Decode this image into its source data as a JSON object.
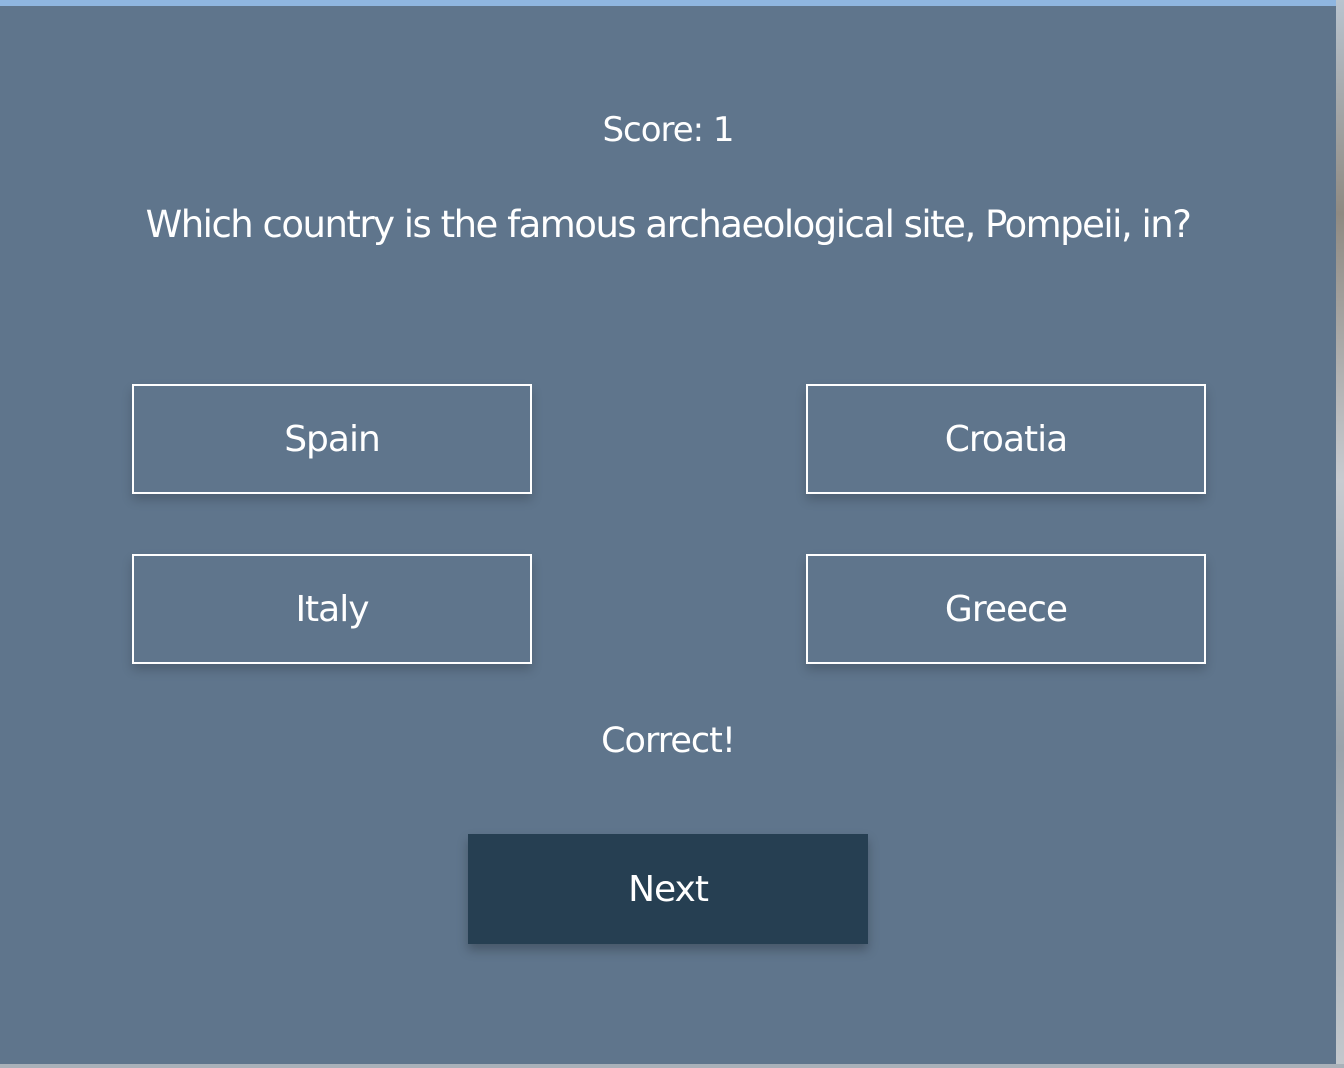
{
  "quiz": {
    "score_text": "Score: 1",
    "question": "Which country is the famous archaeological site, Pompeii, in?",
    "answers": [
      {
        "label": "Spain"
      },
      {
        "label": "Croatia"
      },
      {
        "label": "Italy"
      },
      {
        "label": "Greece"
      }
    ],
    "feedback": "Correct!",
    "next_label": "Next"
  },
  "colors": {
    "panel": "#5f758c",
    "next_button": "#263f52",
    "text": "#ffffff"
  }
}
